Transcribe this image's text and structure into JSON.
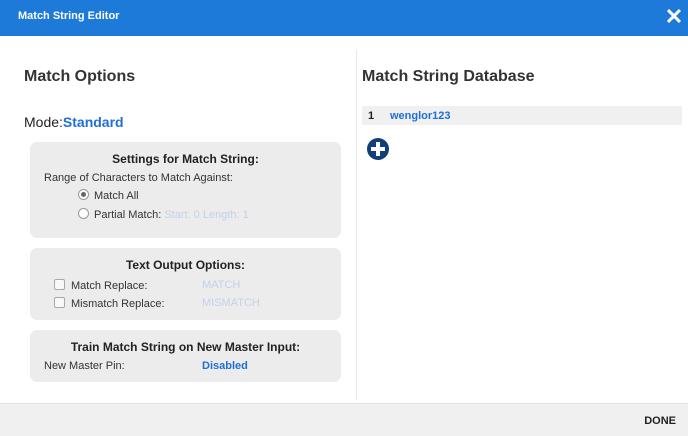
{
  "dialog": {
    "title": "Match String Editor",
    "close_symbol": "✕"
  },
  "left": {
    "heading": "Match Options",
    "mode_label": "Mode:",
    "mode_value": "Standard",
    "settings": {
      "title": "Settings for Match String:",
      "range_label": "Range of Characters to Match Against:",
      "match_all_label": "Match All",
      "partial_label": "Partial Match:",
      "partial_start": "Start: 0",
      "partial_length": "Length: 1"
    },
    "text_output": {
      "title": "Text Output Options:",
      "match_replace_label": "Match Replace:",
      "match_replace_value": "MATCH",
      "mismatch_replace_label": "Mismatch Replace:",
      "mismatch_replace_value": "MISMATCH"
    },
    "train": {
      "title": "Train Match String on New Master Input:",
      "pin_label": "New Master Pin:",
      "pin_value": "Disabled"
    }
  },
  "right": {
    "heading": "Match String Database",
    "entries": [
      {
        "index": "1",
        "value": "wenglor123"
      }
    ]
  },
  "footer": {
    "done_label": "DONE"
  },
  "colors": {
    "titlebar": "#1e7ad8",
    "accent": "#1f6fd6",
    "add_button": "#123f7a",
    "card_bg": "#ececec"
  }
}
